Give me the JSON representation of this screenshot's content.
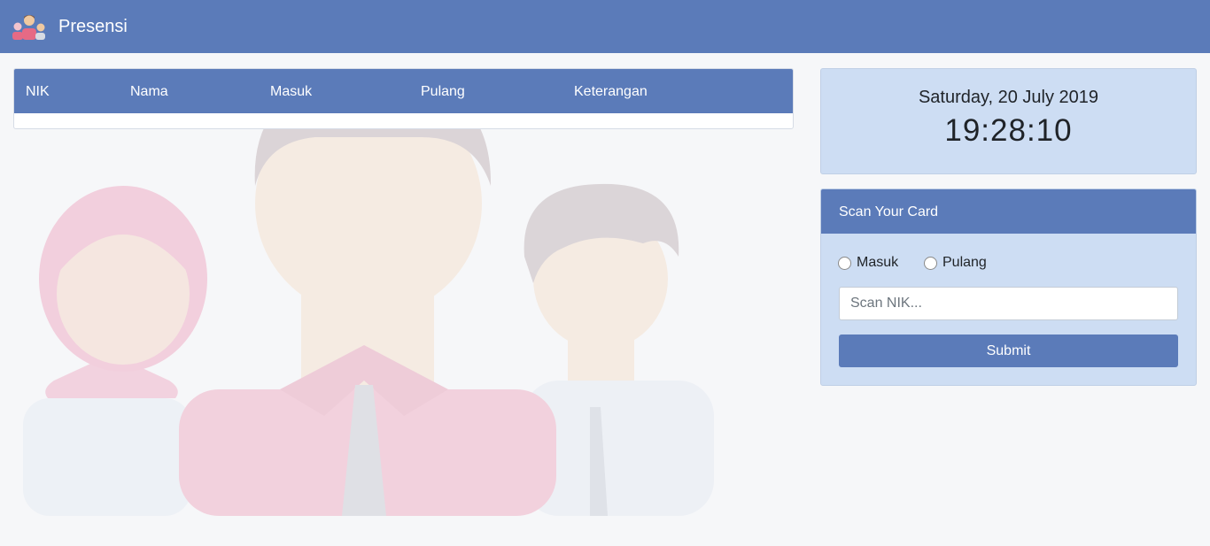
{
  "navbar": {
    "brand": "Presensi",
    "logo_icon": "people-group-icon"
  },
  "table": {
    "columns": [
      "NIK",
      "Nama",
      "Masuk",
      "Pulang",
      "Keterangan"
    ],
    "rows": []
  },
  "clock": {
    "date": "Saturday, 20 July 2019",
    "time": "19:28:10"
  },
  "scan": {
    "title": "Scan Your Card",
    "radio_masuk": "Masuk",
    "radio_pulang": "Pulang",
    "input_placeholder": "Scan NIK...",
    "input_value": "",
    "submit_label": "Submit"
  },
  "colors": {
    "primary": "#5b7bb9",
    "panel": "#cdddf3",
    "background": "#f6f7f9"
  }
}
